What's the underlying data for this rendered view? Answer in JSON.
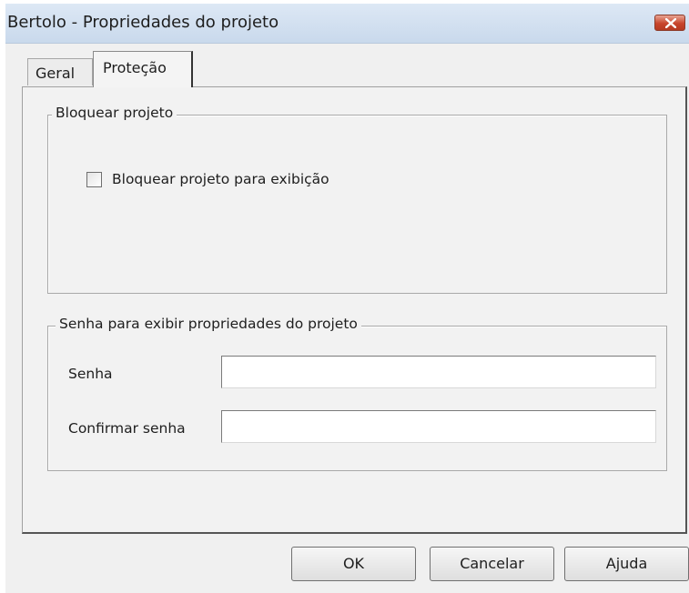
{
  "window": {
    "title": "Bertolo - Propriedades do projeto"
  },
  "tabs": [
    {
      "label": "Geral",
      "selected": false
    },
    {
      "label": "Proteção",
      "selected": true
    }
  ],
  "lock_group": {
    "legend": "Bloquear projeto",
    "checkbox_label": "Bloquear projeto para exibição",
    "checked": false
  },
  "password_group": {
    "legend": "Senha para exibir propriedades do projeto",
    "password_label": "Senha",
    "password_value": "",
    "confirm_label": "Confirmar senha",
    "confirm_value": ""
  },
  "buttons": {
    "ok": "OK",
    "cancel": "Cancelar",
    "help": "Ajuda"
  },
  "colors": {
    "close_button": "#c8452c",
    "titlebar": "#c9d9ec",
    "dialog_bg": "#f0f0f0"
  }
}
